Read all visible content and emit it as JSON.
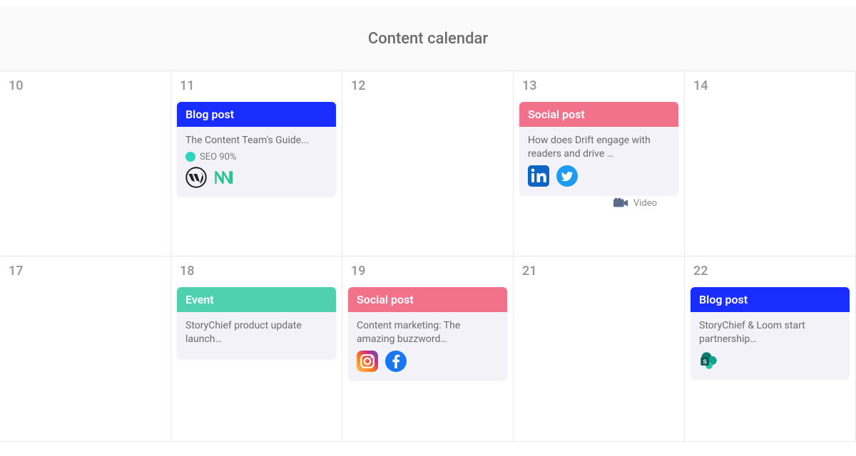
{
  "header": {
    "title": "Content calendar"
  },
  "colors": {
    "blog_post": "#1a2dff",
    "social_post": "#f2728c",
    "event": "#4fd1b0",
    "seo_dot": "#2dd4bf"
  },
  "labels": {
    "blog_post": "Blog post",
    "social_post": "Social post",
    "event": "Event",
    "video": "Video"
  },
  "days": {
    "r1": [
      "10",
      "11",
      "12",
      "13",
      "14"
    ],
    "r2": [
      "17",
      "18",
      "19",
      "21",
      "22"
    ]
  },
  "cards": {
    "d11": {
      "type": "blog_post",
      "title": "The Content Team's Guide...",
      "seo": "SEO 90%",
      "channels": [
        "wordpress",
        "medium"
      ]
    },
    "d13": {
      "type": "social_post",
      "title": "How does Drift engage with readers and drive …",
      "channels": [
        "linkedin",
        "twitter"
      ]
    },
    "d18": {
      "type": "event",
      "title": "StoryChief product update launch…",
      "channels": []
    },
    "d19": {
      "type": "social_post",
      "title": "Content marketing: The amazing buzzword…",
      "channels": [
        "instagram",
        "facebook"
      ]
    },
    "d22": {
      "type": "blog_post",
      "title": "StoryChief & Loom start partnership…",
      "channels": [
        "sharepoint"
      ]
    }
  }
}
